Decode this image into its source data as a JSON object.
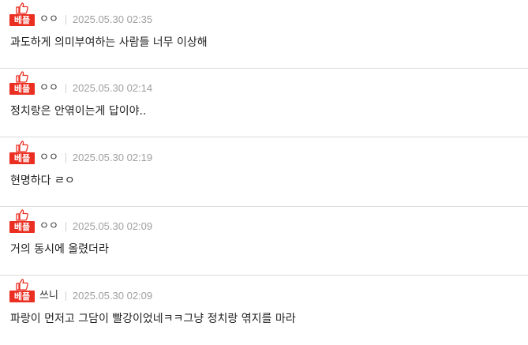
{
  "comments": [
    {
      "badge": "베플",
      "author": "ㅇㅇ",
      "timestamp": "2025.05.30 02:35",
      "text": "과도하게 의미부여하는 사람들 너무 이상해"
    },
    {
      "badge": "베플",
      "author": "ㅇㅇ",
      "timestamp": "2025.05.30 02:14",
      "text": "정치랑은 안엮이는게 답이야.."
    },
    {
      "badge": "베플",
      "author": "ㅇㅇ",
      "timestamp": "2025.05.30 02:19",
      "text": "현명하다 ㄹㅇ"
    },
    {
      "badge": "베플",
      "author": "ㅇㅇ",
      "timestamp": "2025.05.30 02:09",
      "text": "거의 동시에 올렸더라"
    },
    {
      "badge": "베플",
      "author": "쓰니",
      "timestamp": "2025.05.30 02:09",
      "text": "파랑이 먼저고 그담이 빨강이었네ㅋㅋ그냥 정치랑 엮지를 마라"
    }
  ],
  "colors": {
    "badge": "#ea2f22",
    "timestamp": "#a0a0a0",
    "divider": "#dcdcdc"
  },
  "icons": {
    "badge_icon": "thumbs-up-icon"
  }
}
